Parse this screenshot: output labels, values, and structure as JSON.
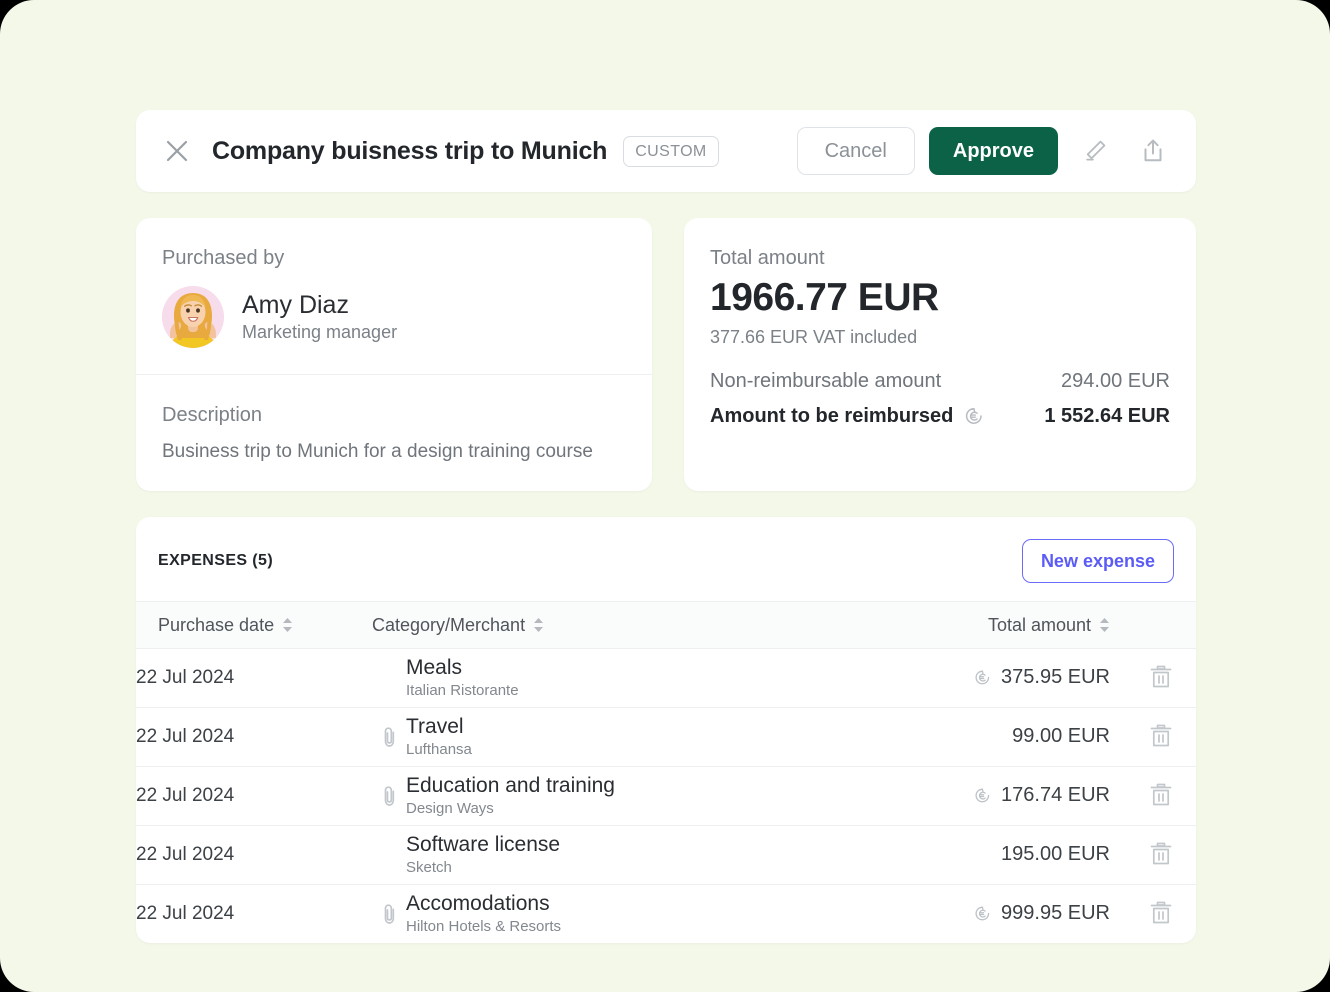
{
  "theme": {
    "page_background": "#f3f8e9",
    "approve_green": "#0b6246",
    "new_expense_accent": "#5b5bf6",
    "card_white": "#ffffff"
  },
  "header": {
    "close_icon": "close-icon",
    "title": "Company buisness trip to Munich",
    "badge": "CUSTOM",
    "cancel_label": "Cancel",
    "approve_label": "Approve",
    "edit_icon": "pencil-icon",
    "share_icon": "share-upload-icon"
  },
  "purchased_by": {
    "label": "Purchased by",
    "name": "Amy Diaz",
    "role": "Marketing manager",
    "avatar_icon": "avatar"
  },
  "description": {
    "label": "Description",
    "text": "Business trip to Munich for a design training course"
  },
  "totals": {
    "label": "Total amount",
    "amount": "1966.77 EUR",
    "vat_note": "377.66 EUR VAT included",
    "non_reimbursable_label": "Non-reimbursable amount",
    "non_reimbursable_value": "294.00 EUR",
    "reimbursed_label": "Amount to be reimbursed",
    "reimbursed_value": "1 552.64 EUR",
    "reimbursed_icon": "euro-refund-icon"
  },
  "expenses": {
    "title": "EXPENSES (5)",
    "new_expense_label": "New expense",
    "columns": [
      {
        "key": "date",
        "label": "Purchase date",
        "sortable": true
      },
      {
        "key": "category",
        "label": "Category/Merchant",
        "sortable": true
      },
      {
        "key": "amount",
        "label": "Total amount",
        "sortable": true
      }
    ],
    "rows": [
      {
        "date": "22 Jul 2024",
        "category": "Meals",
        "merchant": "Italian Ristorante",
        "attachment": false,
        "refund_icon": true,
        "amount": "375.95 EUR"
      },
      {
        "date": "22 Jul 2024",
        "category": "Travel",
        "merchant": "Lufthansa",
        "attachment": true,
        "refund_icon": false,
        "amount": "99.00 EUR"
      },
      {
        "date": "22 Jul 2024",
        "category": "Education and training",
        "merchant": "Design Ways",
        "attachment": true,
        "refund_icon": true,
        "amount": "176.74 EUR"
      },
      {
        "date": "22 Jul 2024",
        "category": "Software license",
        "merchant": "Sketch",
        "attachment": false,
        "refund_icon": false,
        "amount": "195.00 EUR"
      },
      {
        "date": "22 Jul 2024",
        "category": "Accomodations",
        "merchant": "Hilton Hotels & Resorts",
        "attachment": true,
        "refund_icon": true,
        "amount": "999.95 EUR"
      }
    ],
    "row_delete_icon": "trash-icon",
    "attachment_icon": "paperclip-icon"
  }
}
